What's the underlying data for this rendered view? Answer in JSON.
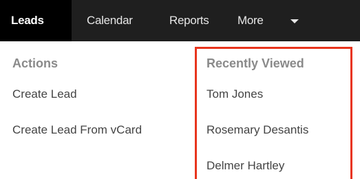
{
  "navbar": {
    "items": [
      {
        "label": "Leads",
        "active": true
      },
      {
        "label": "Calendar",
        "active": false
      },
      {
        "label": "Reports",
        "active": false
      },
      {
        "label": "More",
        "active": false
      }
    ]
  },
  "dropdown": {
    "actions": {
      "title": "Actions",
      "items": [
        "Create Lead",
        "Create Lead From vCard"
      ]
    },
    "recently_viewed": {
      "title": "Recently Viewed",
      "items": [
        "Tom Jones",
        "Rosemary Desantis",
        "Delmer Hartley"
      ]
    }
  },
  "colors": {
    "navbar_bg": "#1f1f1f",
    "active_tab_bg": "#000000",
    "highlight_border": "#e8341c",
    "section_title": "#8a8a8a",
    "link_text": "#444444"
  }
}
